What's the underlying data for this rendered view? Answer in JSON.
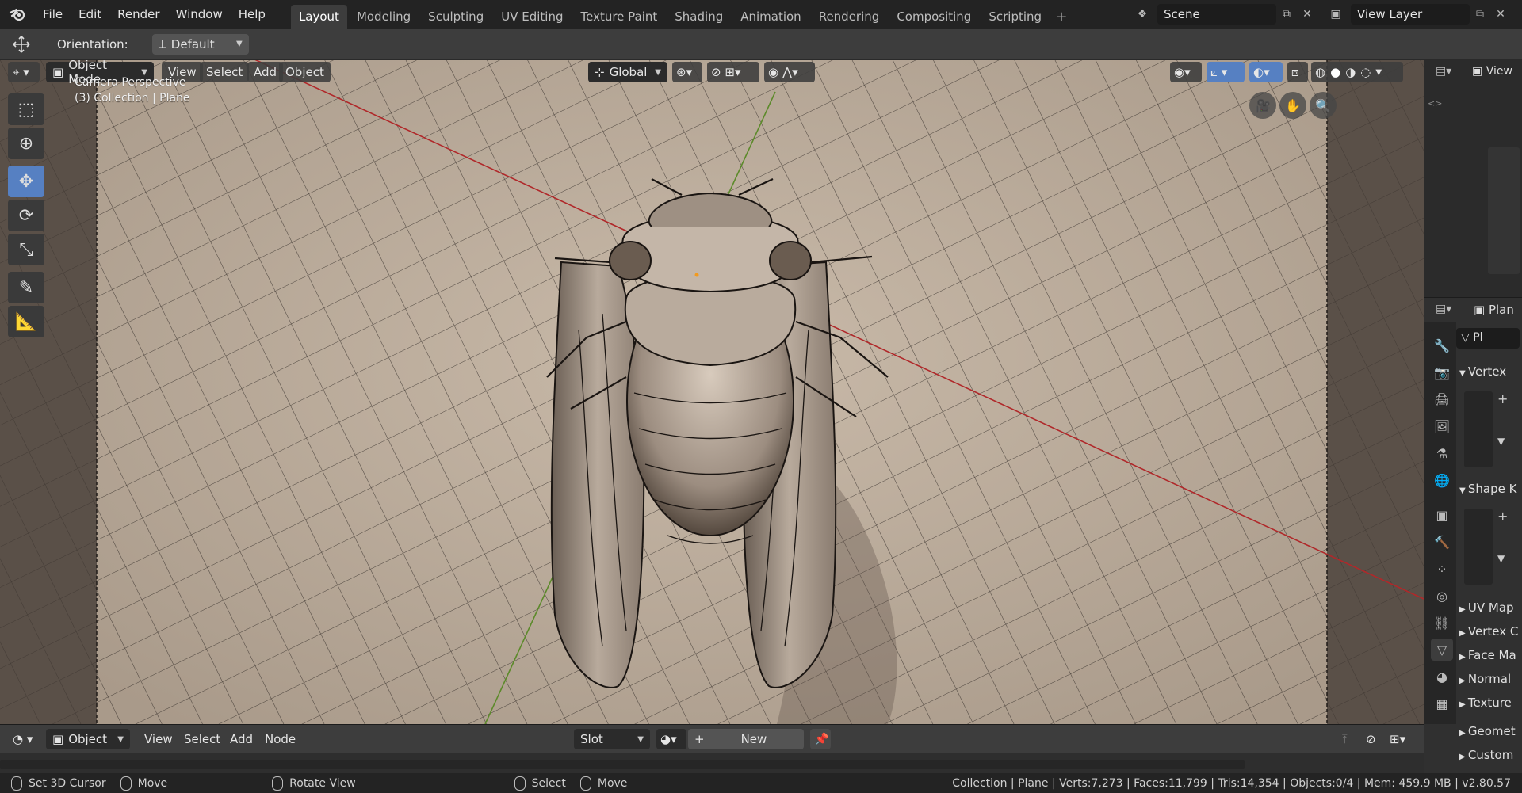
{
  "menu": [
    "File",
    "Edit",
    "Render",
    "Window",
    "Help"
  ],
  "workspaces": [
    {
      "label": "Layout",
      "active": true
    },
    {
      "label": "Modeling"
    },
    {
      "label": "Sculpting"
    },
    {
      "label": "UV Editing"
    },
    {
      "label": "Texture Paint"
    },
    {
      "label": "Shading"
    },
    {
      "label": "Animation"
    },
    {
      "label": "Rendering"
    },
    {
      "label": "Compositing"
    },
    {
      "label": "Scripting"
    }
  ],
  "scene": {
    "name": "Scene"
  },
  "view_layer": {
    "name": "View Layer"
  },
  "toolheader": {
    "orientation_label": "Orientation:",
    "orientation_value": "Default"
  },
  "viewport_header": {
    "mode": "Object Mode",
    "view": "View",
    "select": "Select",
    "add": "Add",
    "object": "Object",
    "transform": "Global"
  },
  "overlay_text": {
    "line1": "Camera Perspective",
    "line2": "(3) Collection | Plane"
  },
  "right_panel": {
    "view_label": "View",
    "object_name": "Plan",
    "data_name": "Pl",
    "sections": [
      "Vertex",
      "Shape K",
      "UV Map",
      "Vertex C",
      "Face Ma",
      "Normal",
      "Texture",
      "Geomet",
      "Custom"
    ]
  },
  "shader_header": {
    "mode": "Object",
    "view": "View",
    "select": "Select",
    "add": "Add",
    "node": "Node",
    "slot": "Slot",
    "new": "New"
  },
  "status": {
    "hint1": "Set 3D Cursor",
    "hint2": "Move",
    "hint3": "Rotate View",
    "hint4": "Select",
    "hint5": "Move",
    "stats": "Collection | Plane | Verts:7,273 | Faces:11,799 | Tris:14,354 | Objects:0/4 | Mem: 459.9 MB | v2.80.57"
  },
  "colors": {
    "accent": "#5680c2",
    "header": "#3d3d3d",
    "bg": "#232323",
    "floor": "#b3a496"
  },
  "icons": [
    "blender-logo-icon",
    "move-icon",
    "select-box-icon",
    "cursor-icon",
    "rotate-icon",
    "scale-icon",
    "annotate-icon",
    "measure-icon",
    "camera-icon",
    "hand-icon",
    "zoom-icon"
  ]
}
